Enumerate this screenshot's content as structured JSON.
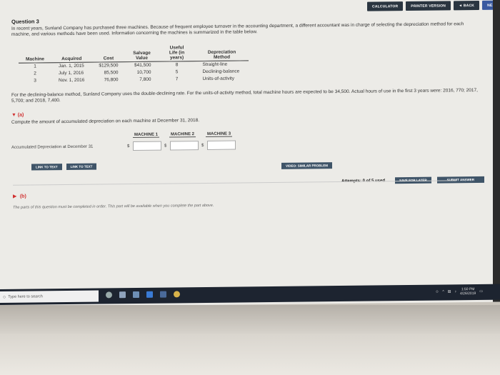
{
  "topbar": {
    "calculator": "CALCULATOR",
    "printer": "PRINTER VERSION",
    "back": "◄ BACK",
    "next": "NEX"
  },
  "question": {
    "title": "Question 3",
    "prompt": "In recent years, Sunland Company has purchased three machines. Because of frequent employee turnover in the accounting department, a different accountant was in charge of selecting the depreciation method for each machine, and various methods have been used. Information concerning the machines is summarized in the table below.",
    "table": {
      "headers": [
        "Machine",
        "Acquired",
        "Cost",
        "Salvage Value",
        "Useful Life (in years)",
        "Depreciation Method"
      ],
      "rows": [
        [
          "1",
          "Jan. 1, 2015",
          "$129,500",
          "$41,500",
          "8",
          "Straight-line"
        ],
        [
          "2",
          "July 1, 2016",
          "85,500",
          "10,700",
          "5",
          "Declining-balance"
        ],
        [
          "3",
          "Nov. 1, 2016",
          "76,800",
          "7,800",
          "7",
          "Units-of-activity"
        ]
      ]
    },
    "note": "For the declining-balance method, Sunland Company uses the double-declining rate. For the units-of-activity method, total machine hours are expected to be 34,500. Actual hours of use in the first 3 years were: 2016, 770; 2017, 5,700; and 2018, 7,400."
  },
  "part_a": {
    "label": "(a)",
    "text": "Compute the amount of accumulated depreciation on each machine at December 31, 2018.",
    "col1": "MACHINE 1",
    "col2": "MACHINE 2",
    "col3": "MACHINE 3",
    "row_label": "Accumulated Depreciation at December 31",
    "currency": "$",
    "link_text_1": "LINK TO TEXT",
    "link_text_2": "LINK TO TEXT",
    "video": "VIDEO: SIMILAR PROBLEM",
    "attempts": "Attempts: 0 of 5 used",
    "save_later": "SAVE FOR LATER",
    "submit": "SUBMIT ANSWER"
  },
  "part_b": {
    "label": "(b)",
    "note": "The parts of this question must be completed in order. This part will be available when you complete the part above."
  },
  "taskbar": {
    "search_placeholder": "Type here to search",
    "time": "1:50 PM",
    "date": "4/26/2019"
  }
}
